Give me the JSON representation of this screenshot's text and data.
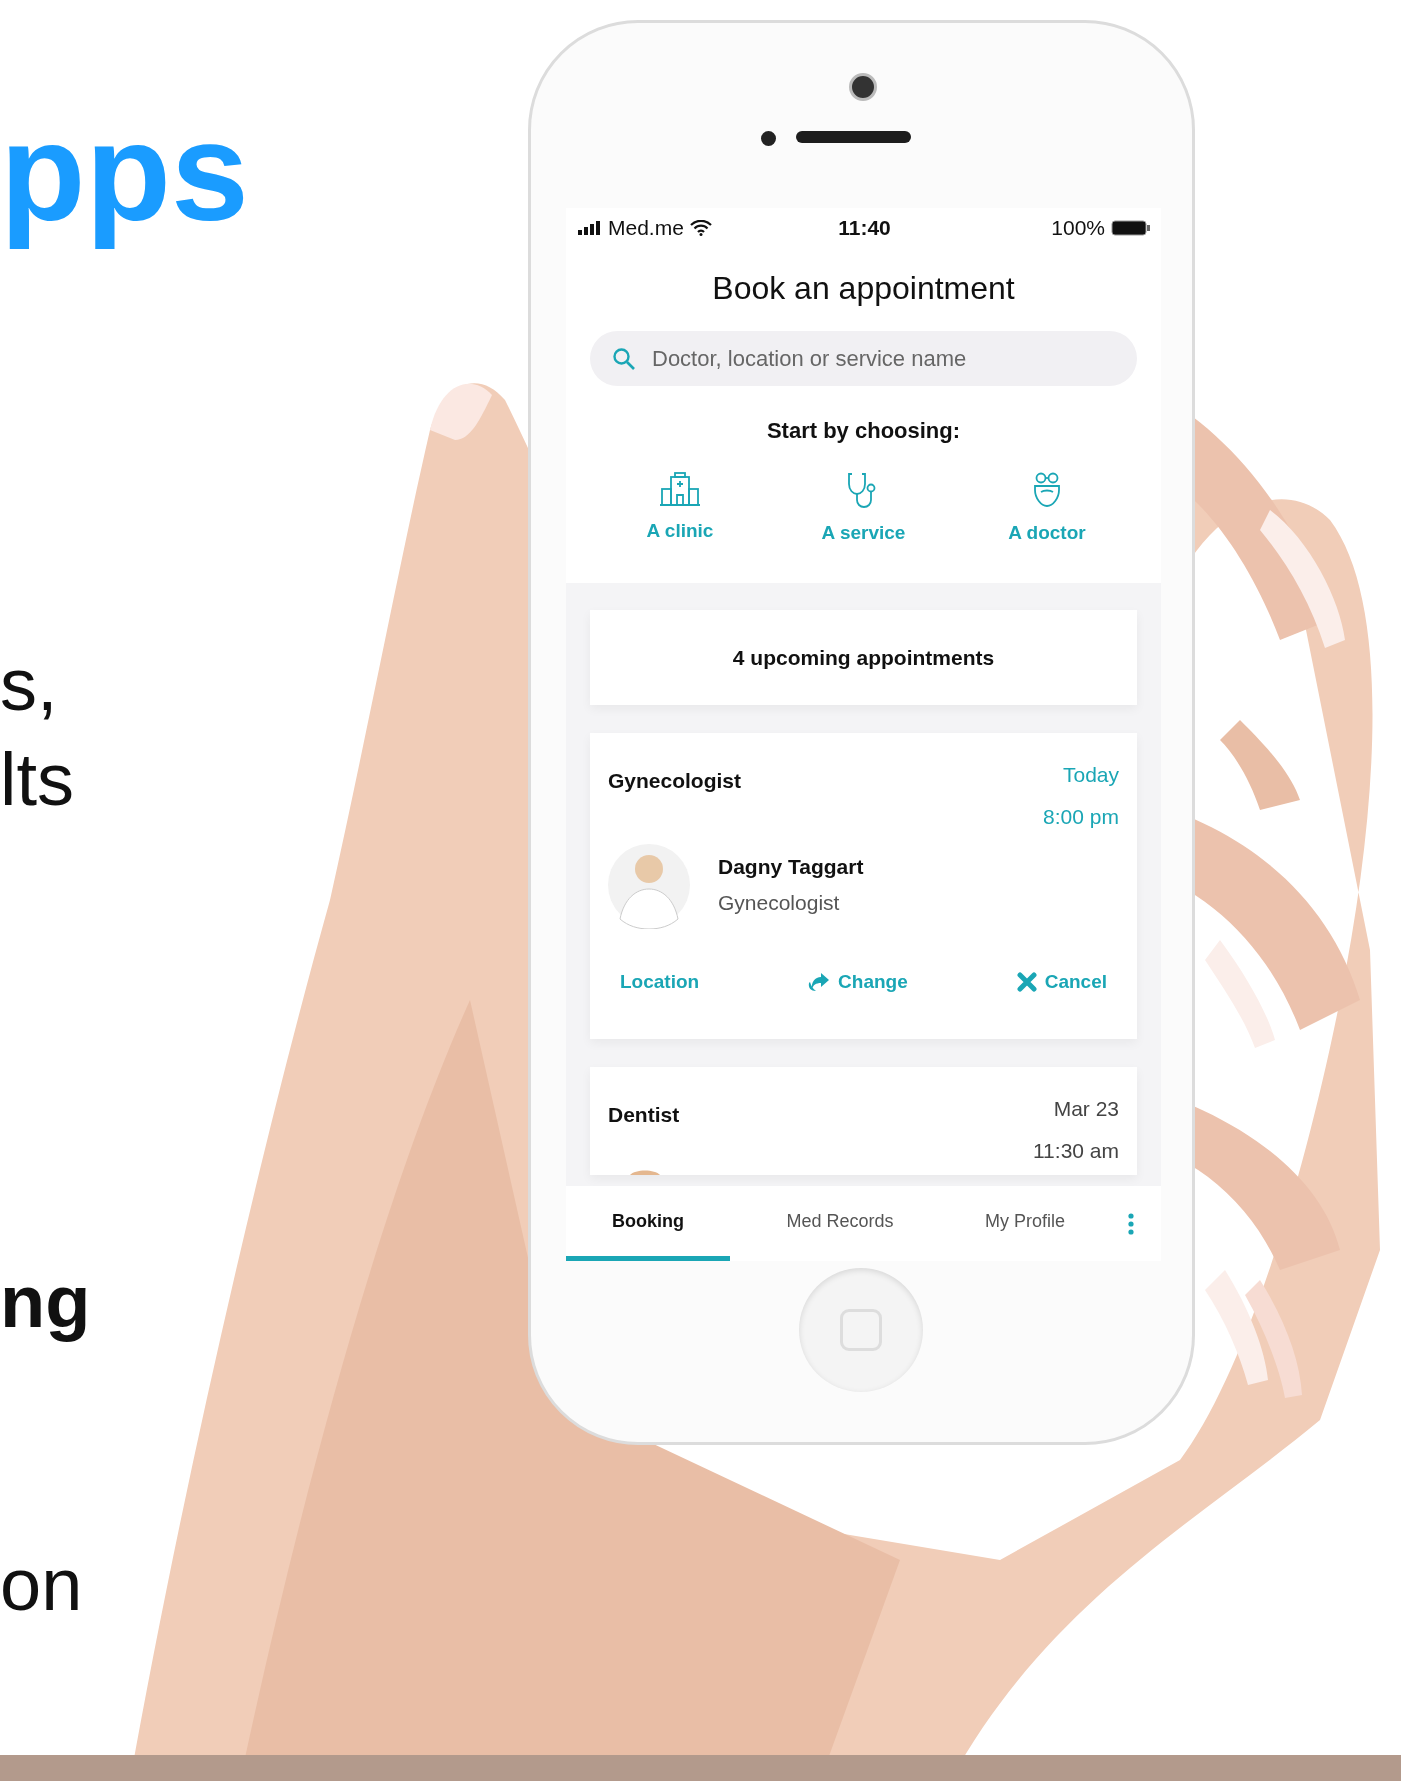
{
  "left_text": {
    "headline": "pps",
    "fragments": [
      {
        "text": "s,",
        "bold": false
      },
      {
        "text": "lts",
        "bold": false
      },
      {
        "text": "ng",
        "bold": true
      },
      {
        "text": "on",
        "bold": false
      }
    ]
  },
  "phone": {
    "status_bar": {
      "carrier": "Med.me",
      "time": "11:40",
      "battery": "100%"
    },
    "title": "Book an appointment",
    "search": {
      "placeholder": "Doctor, location or service name"
    },
    "choose_label": "Start by choosing:",
    "choices": [
      {
        "label": "A clinic",
        "kind": "clinic"
      },
      {
        "label": "A service",
        "kind": "service"
      },
      {
        "label": "A doctor",
        "kind": "doctor"
      }
    ],
    "summary": "4 upcoming appointments",
    "appointments": [
      {
        "specialty": "Gynecologist",
        "date": "Today",
        "time": "8:00 pm",
        "highlighted": true,
        "doctor": {
          "name": "Dagny Taggart",
          "role": "Gynecologist"
        },
        "actions": [
          {
            "label": "Location",
            "kind": "location"
          },
          {
            "label": "Change",
            "kind": "change"
          },
          {
            "label": "Cancel",
            "kind": "cancel"
          }
        ]
      },
      {
        "specialty": "Dentist",
        "date": "Mar 23",
        "time": "11:30 am",
        "highlighted": false
      }
    ],
    "tabs": [
      {
        "label": "Booking",
        "selected": true
      },
      {
        "label": "Med Records",
        "selected": false
      },
      {
        "label": "My Profile",
        "selected": false
      }
    ]
  }
}
